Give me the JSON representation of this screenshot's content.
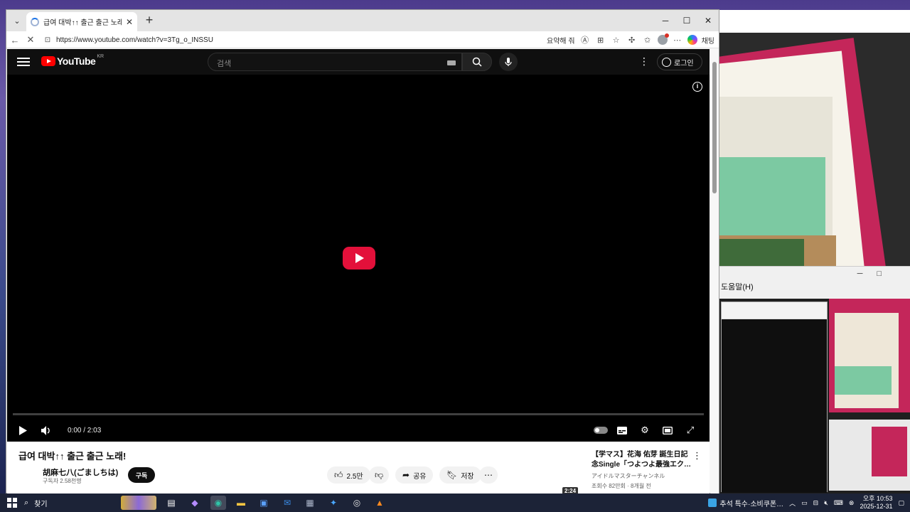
{
  "browser": {
    "tab_title": "급여 대박↑↑ 출근 출근 노래! - YouTube",
    "url": "https://www.youtube.com/watch?v=3Tg_o_INSSU",
    "summarize_label": "요약해 줘",
    "chat_label": "채팅"
  },
  "youtube": {
    "logo_text": "YouTube",
    "logo_region": "KR",
    "search_placeholder": "검색",
    "login_label": "로그인",
    "time": "0:00 / 2:03",
    "video_title": "급여 대박↑↑ 출근 출근 노래!",
    "channel_name": "胡麻七八(ごましちは)",
    "subscribers": "구독자 2.58천명",
    "subscribe_label": "구독",
    "like_count": "2.5만",
    "share_label": "공유",
    "save_label": "저장"
  },
  "recommendation": {
    "title": "【学マス】花海 佑芽 誕生日記念Single「つよつよ最強エク…",
    "channel": "アイドルマスターチャンネル",
    "meta": "조회수 82만회 · 8개월 전",
    "duration": "2:24"
  },
  "background_window": {
    "menu_help": "도움말(H)"
  },
  "taskbar": {
    "search_label": "찾기",
    "news_text": "추석 특수·소비쿠폰…",
    "time": "오후 10:53",
    "date": "2025-12-31"
  },
  "colors": {
    "youtube_red": "#ff0000",
    "play_button_red": "#e3103a",
    "yt_dark": "#0f0f0f"
  }
}
